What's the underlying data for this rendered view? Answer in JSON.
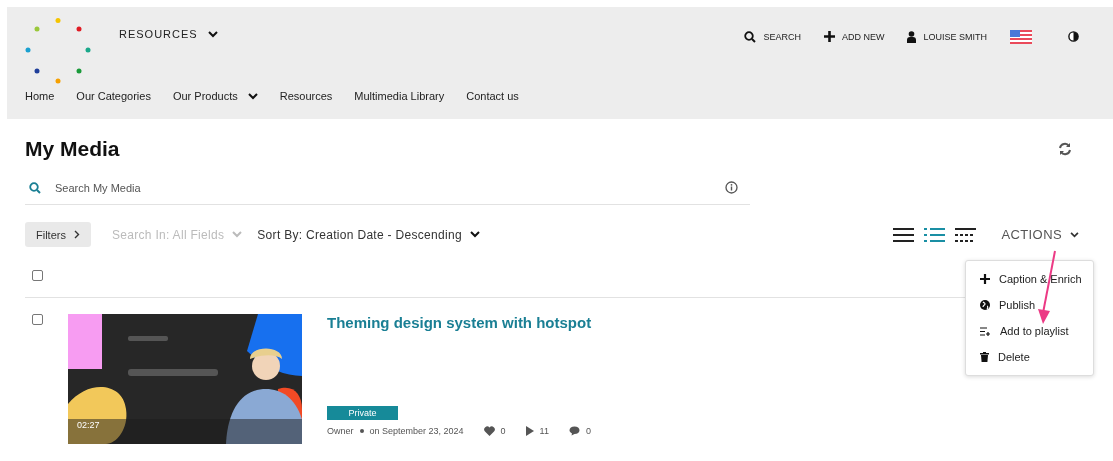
{
  "header": {
    "menu": {
      "label": "RESOURCES"
    },
    "actions": [
      {
        "kind": "search",
        "label": "SEARCH"
      },
      {
        "kind": "add",
        "label": "ADD NEW"
      },
      {
        "kind": "user",
        "label": "LOUISE SMITH"
      }
    ],
    "nav": [
      {
        "label": "Home",
        "dropdown": false
      },
      {
        "label": "Our Categories",
        "dropdown": false
      },
      {
        "label": "Our Products",
        "dropdown": true
      },
      {
        "label": "Resources",
        "dropdown": false
      },
      {
        "label": "Multimedia Library",
        "dropdown": false
      },
      {
        "label": "Contact us",
        "dropdown": false
      }
    ]
  },
  "page": {
    "title": "My Media",
    "search": {
      "placeholder": "Search My Media"
    },
    "filters": "Filters",
    "search_in": {
      "label": "Search In: All Fields",
      "disabled": true
    },
    "sort": "Sort By: Creation Date - Descending",
    "view_modes": [
      {
        "kind": "list",
        "selected": false
      },
      {
        "kind": "detailed",
        "selected": true
      },
      {
        "kind": "grid",
        "selected": false
      }
    ],
    "actions": {
      "label": "ACTIONS",
      "expanded": true,
      "items": [
        {
          "kind": "caption",
          "label": "Caption & Enrich"
        },
        {
          "kind": "publish",
          "label": "Publish"
        },
        {
          "kind": "playlist",
          "label": "Add to playlist"
        },
        {
          "kind": "delete",
          "label": "Delete"
        }
      ]
    },
    "select_all": {
      "checked": false
    },
    "media": [
      {
        "title": "Theming design system with hotspot",
        "checked": false,
        "duration": "02:27",
        "status": "Private",
        "owner": "Owner",
        "date": "on September 23, 2024",
        "likes": "0",
        "plays": "11",
        "comments": "0"
      }
    ]
  }
}
